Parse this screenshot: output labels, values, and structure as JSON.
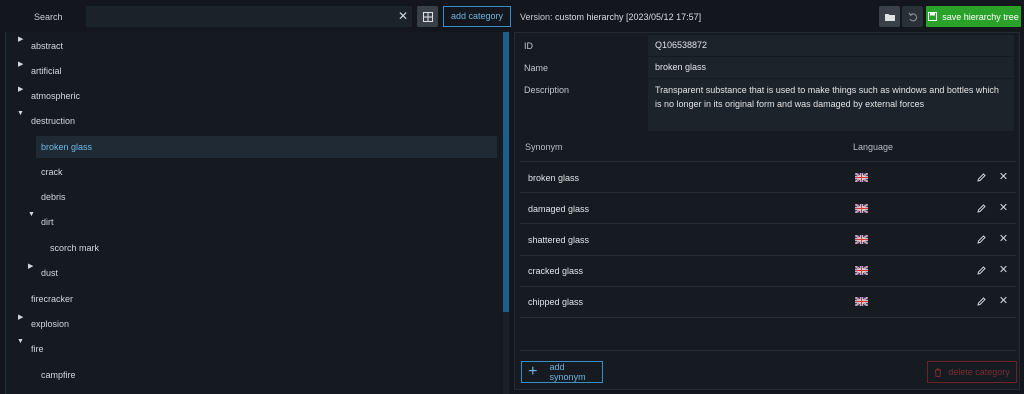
{
  "search": {
    "label": "Search",
    "value": "",
    "placeholder": ""
  },
  "toolbar": {
    "add_category": "add category",
    "version_label": "Version:",
    "version_value": "custom hierarchy [2023/05/12 17:57]",
    "save_label": "save hierarchy tree"
  },
  "tree": {
    "items": [
      {
        "label": "abstract",
        "expanded": false,
        "has_children": true
      },
      {
        "label": "artificial",
        "expanded": false,
        "has_children": true
      },
      {
        "label": "atmospheric",
        "expanded": false,
        "has_children": true
      },
      {
        "label": "destruction",
        "expanded": true,
        "has_children": true
      },
      {
        "label": "broken glass",
        "selected": true
      },
      {
        "label": "crack"
      },
      {
        "label": "debris"
      },
      {
        "label": "dirt",
        "expanded": true,
        "has_children": true
      },
      {
        "label": "scorch mark"
      },
      {
        "label": "dust",
        "expanded": false,
        "has_children": true
      },
      {
        "label": "firecracker"
      },
      {
        "label": "explosion",
        "expanded": false,
        "has_children": true
      },
      {
        "label": "fire",
        "expanded": true,
        "has_children": true
      },
      {
        "label": "campfire"
      }
    ]
  },
  "details": {
    "id_label": "ID",
    "id_value": "Q106538872",
    "name_label": "Name",
    "name_value": "broken glass",
    "desc_label": "Description",
    "desc_value": "Transparent substance that is used to make things such as windows and bottles which is no longer in its original form and was damaged by external forces"
  },
  "synonyms": {
    "col_synonym": "Synonym",
    "col_language": "Language",
    "rows": [
      {
        "text": "broken glass",
        "language": "uk-flag-icon"
      },
      {
        "text": "damaged glass",
        "language": "uk-flag-icon"
      },
      {
        "text": "shattered glass",
        "language": "uk-flag-icon"
      },
      {
        "text": "cracked glass",
        "language": "uk-flag-icon"
      },
      {
        "text": "chipped glass",
        "language": "uk-flag-icon"
      }
    ],
    "add_label": "add synonym",
    "delete_label": "delete category"
  },
  "colors": {
    "accent": "#3a8ec5",
    "save_green": "#2aa22a",
    "danger": "#6b2327",
    "selected_text": "#6fb8e8"
  }
}
